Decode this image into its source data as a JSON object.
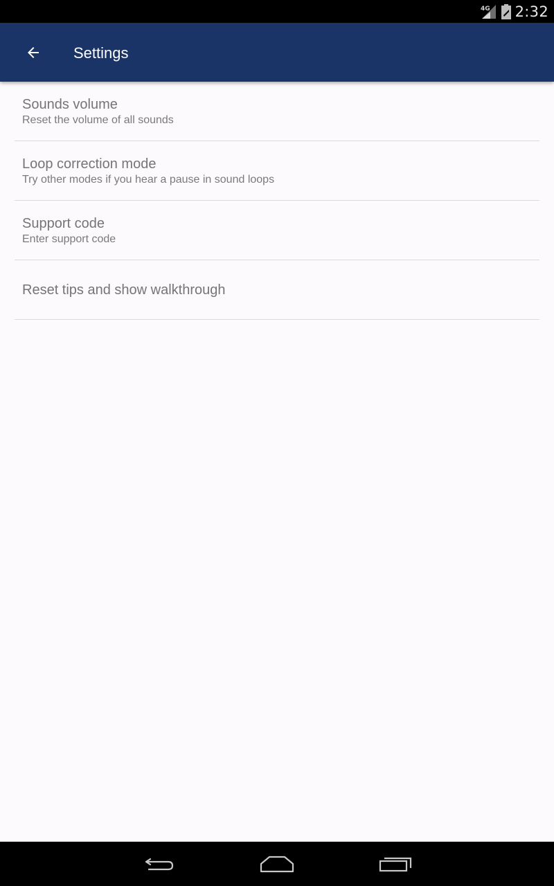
{
  "status_bar": {
    "network_label": "4G",
    "time": "2:32",
    "icons": [
      "signal-icon",
      "battery-icon"
    ]
  },
  "app_bar": {
    "title": "Settings",
    "back_icon": "arrow-left-icon",
    "color": "#1a3468"
  },
  "settings": {
    "items": [
      {
        "title": "Sounds volume",
        "summary": "Reset the volume of all sounds"
      },
      {
        "title": "Loop correction mode",
        "summary": "Try other modes if you hear a pause in sound loops"
      },
      {
        "title": "Support code",
        "summary": "Enter support code"
      },
      {
        "title": "Reset tips and show walkthrough",
        "summary": ""
      }
    ]
  },
  "nav_bar": {
    "buttons": [
      "back-nav-icon",
      "home-nav-icon",
      "recents-nav-icon"
    ]
  }
}
